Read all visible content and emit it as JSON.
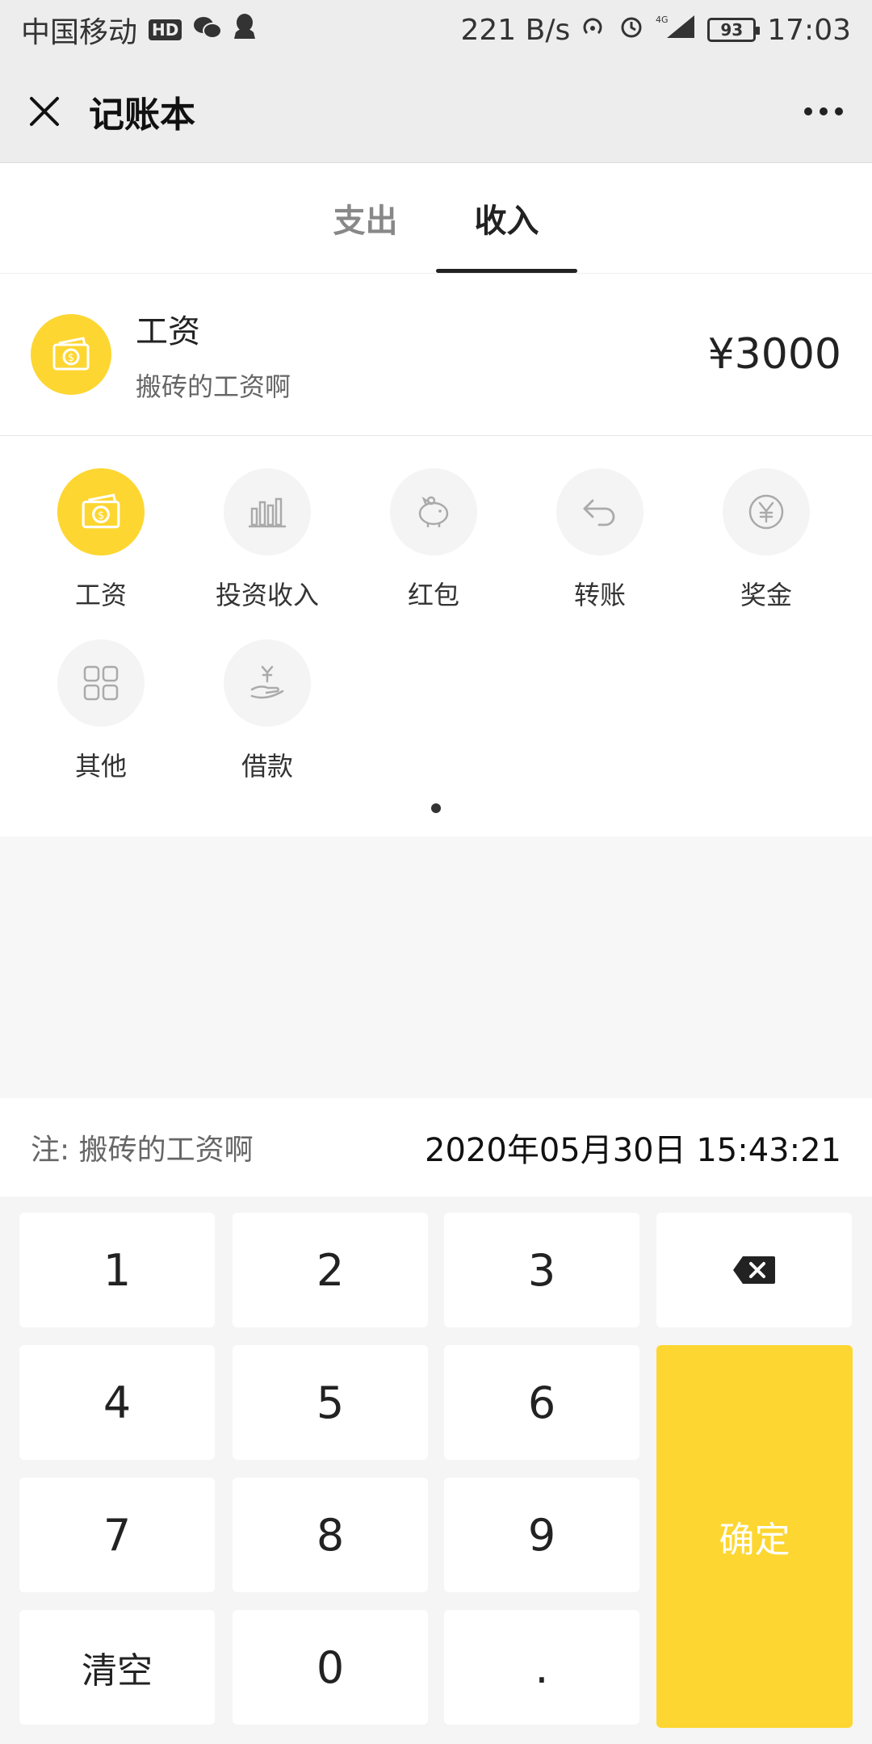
{
  "status_bar": {
    "carrier": "中国移动",
    "hd": "HD",
    "speed": "221 B/s",
    "battery": "93",
    "time": "17:03"
  },
  "nav": {
    "title": "记账本"
  },
  "tabs": [
    {
      "label": "支出",
      "active": false
    },
    {
      "label": "收入",
      "active": true
    }
  ],
  "entry": {
    "category": "工资",
    "note": "搬砖的工资啊",
    "amount": "¥3000"
  },
  "categories": [
    {
      "label": "工资",
      "icon": "cash-icon",
      "selected": true
    },
    {
      "label": "投资收入",
      "icon": "chart-bars-icon",
      "selected": false
    },
    {
      "label": "红包",
      "icon": "piggy-bank-icon",
      "selected": false
    },
    {
      "label": "转账",
      "icon": "return-arrow-icon",
      "selected": false
    },
    {
      "label": "奖金",
      "icon": "yen-coin-icon",
      "selected": false
    },
    {
      "label": "其他",
      "icon": "grid-icon",
      "selected": false
    },
    {
      "label": "借款",
      "icon": "hand-yen-icon",
      "selected": false
    }
  ],
  "note_bar": {
    "note": "注: 搬砖的工资啊",
    "datetime": "2020年05月30日 15:43:21"
  },
  "keypad": {
    "keys": [
      "1",
      "2",
      "3",
      "4",
      "5",
      "6",
      "7",
      "8",
      "9",
      "清空",
      "0",
      "."
    ],
    "confirm": "确定",
    "backspace_icon": "backspace-icon"
  },
  "colors": {
    "accent": "#fdd631",
    "background": "#f7f7f7",
    "header": "#ededed"
  }
}
